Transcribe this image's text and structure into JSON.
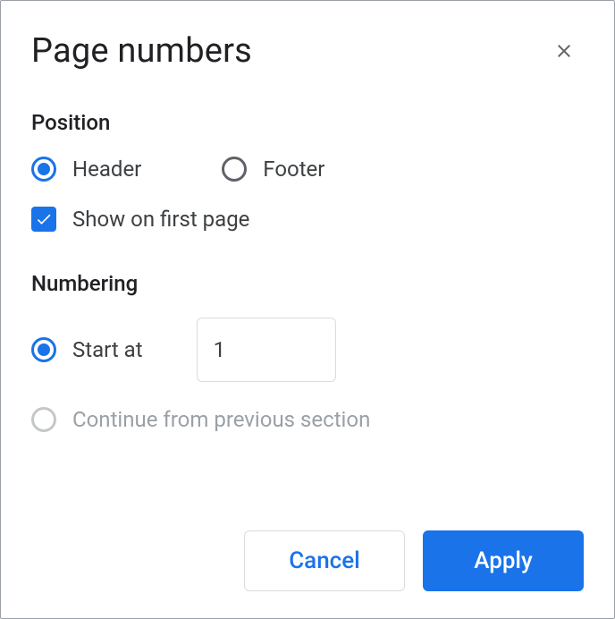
{
  "dialog": {
    "title": "Page numbers"
  },
  "position": {
    "section_label": "Position",
    "header_label": "Header",
    "footer_label": "Footer",
    "selected": "header",
    "show_first_label": "Show on first page",
    "show_first_checked": true
  },
  "numbering": {
    "section_label": "Numbering",
    "start_at_label": "Start at",
    "start_at_value": "1",
    "continue_label": "Continue from previous section",
    "selected": "start_at",
    "continue_enabled": false
  },
  "actions": {
    "cancel": "Cancel",
    "apply": "Apply"
  }
}
